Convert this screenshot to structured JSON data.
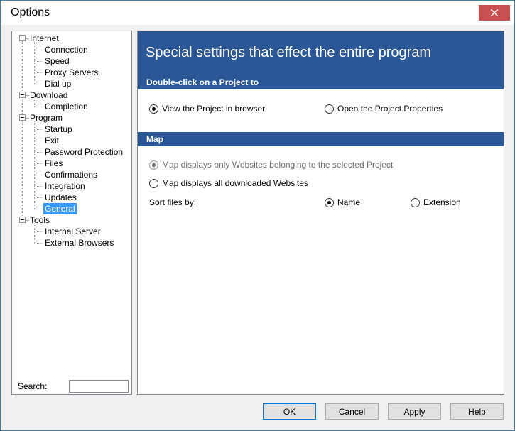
{
  "window": {
    "title": "Options"
  },
  "tree": [
    {
      "label": "Internet",
      "level": 0,
      "name": "tree-node-internet"
    },
    {
      "label": "Connection",
      "level": 1,
      "name": "tree-node-connection"
    },
    {
      "label": "Speed",
      "level": 1,
      "name": "tree-node-speed"
    },
    {
      "label": "Proxy Servers",
      "level": 1,
      "name": "tree-node-proxy-servers"
    },
    {
      "label": "Dial up",
      "level": 1,
      "name": "tree-node-dial-up"
    },
    {
      "label": "Download",
      "level": 0,
      "name": "tree-node-download"
    },
    {
      "label": "Completion",
      "level": 1,
      "name": "tree-node-completion"
    },
    {
      "label": "Program",
      "level": 0,
      "name": "tree-node-program"
    },
    {
      "label": "Startup",
      "level": 1,
      "name": "tree-node-startup"
    },
    {
      "label": "Exit",
      "level": 1,
      "name": "tree-node-exit"
    },
    {
      "label": "Password Protection",
      "level": 1,
      "name": "tree-node-password-protection"
    },
    {
      "label": "Files",
      "level": 1,
      "name": "tree-node-files"
    },
    {
      "label": "Confirmations",
      "level": 1,
      "name": "tree-node-confirmations"
    },
    {
      "label": "Integration",
      "level": 1,
      "name": "tree-node-integration"
    },
    {
      "label": "Updates",
      "level": 1,
      "name": "tree-node-updates"
    },
    {
      "label": "General",
      "level": 1,
      "name": "tree-node-general",
      "selected": true
    },
    {
      "label": "Tools",
      "level": 0,
      "name": "tree-node-tools"
    },
    {
      "label": "Internal Server",
      "level": 1,
      "name": "tree-node-internal-server"
    },
    {
      "label": "External Browsers",
      "level": 1,
      "name": "tree-node-external-browsers"
    }
  ],
  "search": {
    "label": "Search:",
    "value": ""
  },
  "content": {
    "title": "Special settings that effect the entire program",
    "double_click": {
      "header": "Double-click on a Project to",
      "option_view": "View the Project in browser",
      "option_open": "Open the Project Properties",
      "selected": "view"
    },
    "map": {
      "header": "Map",
      "option_selected_project": "Map displays only Websites belonging to the selected Project",
      "option_all": "Map displays all downloaded Websites",
      "selected": "selected_project",
      "sort_label": "Sort files by:",
      "sort_name": "Name",
      "sort_extension": "Extension",
      "sort_selected": "name"
    }
  },
  "buttons": {
    "ok": "OK",
    "cancel": "Cancel",
    "apply": "Apply",
    "help": "Help"
  },
  "colors": {
    "accent": "#2b5797",
    "selection": "#3399ff",
    "close": "#c75050"
  }
}
